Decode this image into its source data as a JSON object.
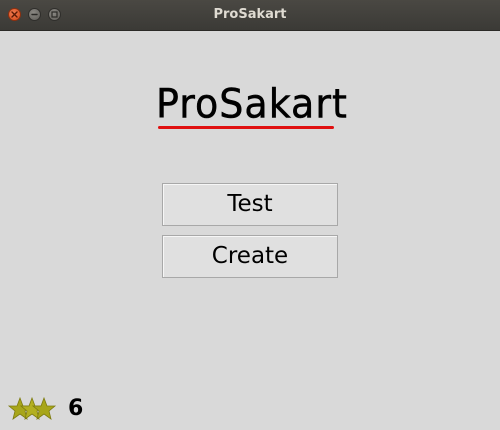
{
  "window": {
    "title": "ProSakart"
  },
  "logo": {
    "text": "ProSakart",
    "underline_color": "#e01010"
  },
  "buttons": {
    "test_label": "Test",
    "create_label": "Create"
  },
  "footer": {
    "stars_icon": "stars-icon",
    "star_color": "#a8a61a",
    "score": "6"
  },
  "titlebar_buttons": {
    "close_icon": "close-icon",
    "minimize_icon": "minimize-icon",
    "maximize_icon": "maximize-icon"
  }
}
